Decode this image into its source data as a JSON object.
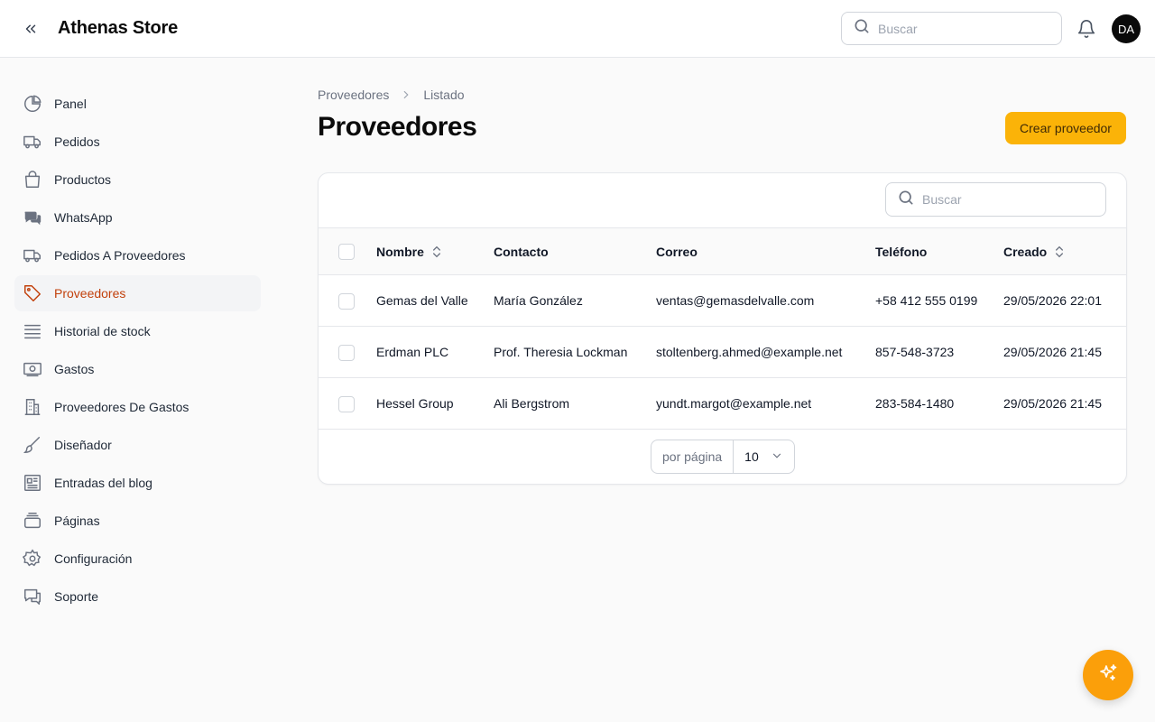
{
  "header": {
    "brand": "Athenas Store",
    "search_placeholder": "Buscar",
    "avatar_initials": "DA"
  },
  "sidebar": {
    "items": [
      {
        "label": "Panel",
        "icon": "pie-chart-icon"
      },
      {
        "label": "Pedidos",
        "icon": "truck-icon"
      },
      {
        "label": "Productos",
        "icon": "shopping-bag-icon"
      },
      {
        "label": "WhatsApp",
        "icon": "chat-bubbles-icon"
      },
      {
        "label": "Pedidos A Proveedores",
        "icon": "truck-icon"
      },
      {
        "label": "Proveedores",
        "icon": "tag-icon",
        "active": true
      },
      {
        "label": "Historial de stock",
        "icon": "list-icon"
      },
      {
        "label": "Gastos",
        "icon": "banknote-icon"
      },
      {
        "label": "Proveedores De Gastos",
        "icon": "building-icon"
      },
      {
        "label": "Diseñador",
        "icon": "paintbrush-icon"
      },
      {
        "label": "Entradas del blog",
        "icon": "newspaper-icon"
      },
      {
        "label": "Páginas",
        "icon": "stack-icon"
      },
      {
        "label": "Configuración",
        "icon": "gear-icon"
      },
      {
        "label": "Soporte",
        "icon": "support-chat-icon"
      }
    ]
  },
  "breadcrumb": {
    "parent": "Proveedores",
    "current": "Listado"
  },
  "page": {
    "title": "Proveedores",
    "create_label": "Crear proveedor"
  },
  "table": {
    "search_placeholder": "Buscar",
    "columns": [
      "Nombre",
      "Contacto",
      "Correo",
      "Teléfono",
      "Creado"
    ],
    "rows": [
      {
        "nombre": "Gemas del Valle",
        "contacto": "María González",
        "correo": "ventas@gemasdelvalle.com",
        "telefono": "+58 412 555 0199",
        "creado": "29/05/2026 22:01"
      },
      {
        "nombre": "Erdman PLC",
        "contacto": "Prof. Theresia Lockman",
        "correo": "stoltenberg.ahmed@example.net",
        "telefono": "857-548-3723",
        "creado": "29/05/2026 21:45"
      },
      {
        "nombre": "Hessel Group",
        "contacto": "Ali Bergstrom",
        "correo": "yundt.margot@example.net",
        "telefono": "283-584-1480",
        "creado": "29/05/2026 21:45"
      }
    ]
  },
  "pagination": {
    "per_page_label": "por página",
    "per_page_value": "10"
  },
  "colors": {
    "accent": "#fbb308",
    "active_text": "#c2410c",
    "fab": "#fb9f0a"
  }
}
